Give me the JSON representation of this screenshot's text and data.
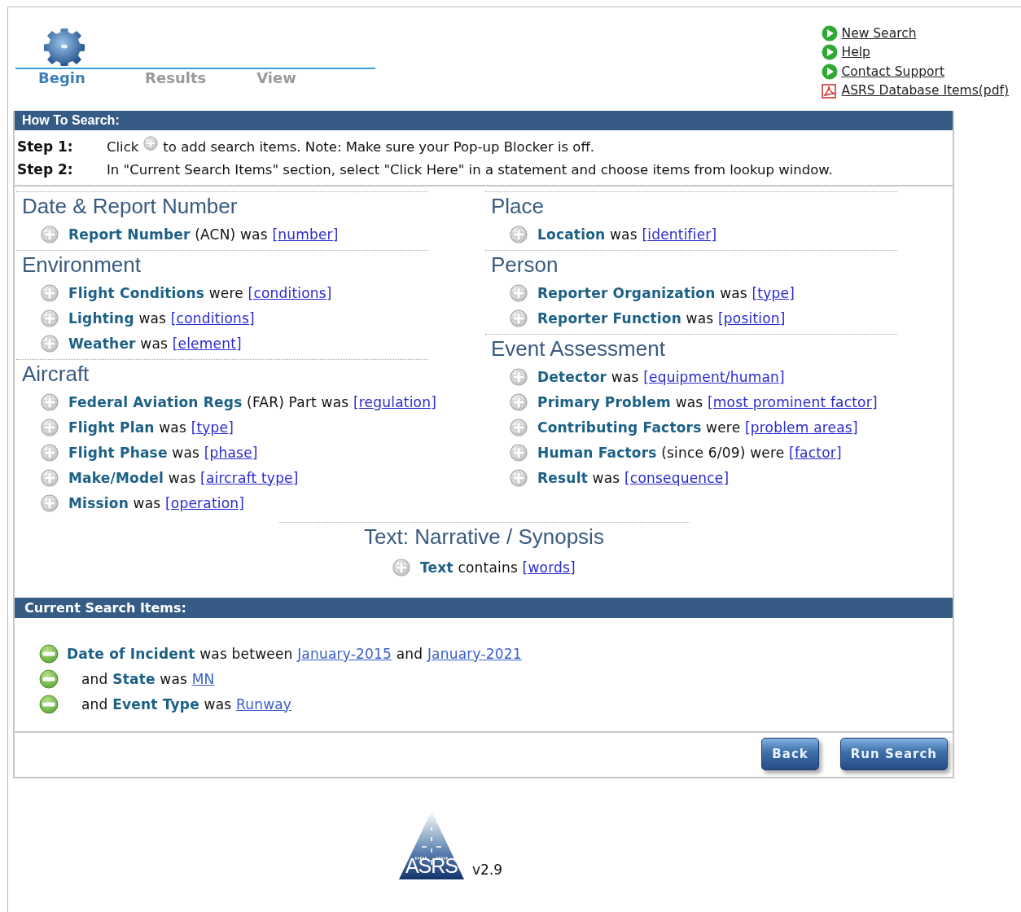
{
  "steps": [
    {
      "label": "Begin",
      "selected": true
    },
    {
      "label": "Results",
      "selected": false
    },
    {
      "label": "View",
      "selected": false
    }
  ],
  "top_links": [
    {
      "kind": "arrow",
      "label": "New Search"
    },
    {
      "kind": "arrow",
      "label": "Help"
    },
    {
      "kind": "arrow",
      "label": "Contact Support"
    },
    {
      "kind": "pdf",
      "label": "ASRS Database Items(pdf)"
    }
  ],
  "how_to": {
    "title": "How To Search:",
    "steps": [
      {
        "label": "Step 1:",
        "before": "Click",
        "after": "to add search items. Note: Make sure your Pop-up Blocker is off."
      },
      {
        "label": "Step 2:",
        "text": "In \"Current Search Items\" section, select \"Click Here\" in a statement and choose items from lookup window."
      }
    ]
  },
  "columns": [
    [
      {
        "title": "Date & Report Number",
        "items": [
          [
            {
              "kind": "bold",
              "text": "Report Number"
            },
            {
              "kind": "plain",
              "text": "(ACN) was"
            },
            {
              "kind": "link",
              "text": "[number]"
            }
          ]
        ]
      },
      {
        "title": "Environment",
        "items": [
          [
            {
              "kind": "bold",
              "text": "Flight Conditions"
            },
            {
              "kind": "plain",
              "text": "were"
            },
            {
              "kind": "link",
              "text": "[conditions]"
            }
          ],
          [
            {
              "kind": "bold",
              "text": "Lighting"
            },
            {
              "kind": "plain",
              "text": "was"
            },
            {
              "kind": "link",
              "text": "[conditions]"
            }
          ],
          [
            {
              "kind": "bold",
              "text": "Weather"
            },
            {
              "kind": "plain",
              "text": "was"
            },
            {
              "kind": "link",
              "text": "[element]"
            }
          ]
        ]
      },
      {
        "title": "Aircraft",
        "items": [
          [
            {
              "kind": "bold",
              "text": "Federal Aviation Regs"
            },
            {
              "kind": "plain",
              "text": "(FAR) Part was"
            },
            {
              "kind": "link",
              "text": "[regulation]"
            }
          ],
          [
            {
              "kind": "bold",
              "text": "Flight Plan"
            },
            {
              "kind": "plain",
              "text": "was"
            },
            {
              "kind": "link",
              "text": "[type]"
            }
          ],
          [
            {
              "kind": "bold",
              "text": "Flight Phase"
            },
            {
              "kind": "plain",
              "text": "was"
            },
            {
              "kind": "link",
              "text": "[phase]"
            }
          ],
          [
            {
              "kind": "bold",
              "text": "Make/Model"
            },
            {
              "kind": "plain",
              "text": "was"
            },
            {
              "kind": "link",
              "text": "[aircraft type]"
            }
          ],
          [
            {
              "kind": "bold",
              "text": "Mission"
            },
            {
              "kind": "plain",
              "text": "was"
            },
            {
              "kind": "link",
              "text": "[operation]"
            }
          ]
        ]
      }
    ],
    [
      {
        "title": "Place",
        "items": [
          [
            {
              "kind": "bold",
              "text": "Location"
            },
            {
              "kind": "plain",
              "text": "was"
            },
            {
              "kind": "link",
              "text": "[identifier]"
            }
          ]
        ]
      },
      {
        "title": "Person",
        "items": [
          [
            {
              "kind": "bold",
              "text": "Reporter Organization"
            },
            {
              "kind": "plain",
              "text": "was"
            },
            {
              "kind": "link",
              "text": "[type]"
            }
          ],
          [
            {
              "kind": "bold",
              "text": "Reporter Function"
            },
            {
              "kind": "plain",
              "text": "was"
            },
            {
              "kind": "link",
              "text": "[position]"
            }
          ]
        ]
      },
      {
        "title": "Event Assessment",
        "items": [
          [
            {
              "kind": "bold",
              "text": "Detector"
            },
            {
              "kind": "plain",
              "text": "was"
            },
            {
              "kind": "link",
              "text": "[equipment/human]"
            }
          ],
          [
            {
              "kind": "bold",
              "text": "Primary Problem"
            },
            {
              "kind": "plain",
              "text": "was"
            },
            {
              "kind": "link",
              "text": "[most prominent factor]"
            }
          ],
          [
            {
              "kind": "bold",
              "text": "Contributing Factors"
            },
            {
              "kind": "plain",
              "text": "were"
            },
            {
              "kind": "link",
              "text": "[problem areas]"
            }
          ],
          [
            {
              "kind": "bold",
              "text": "Human Factors"
            },
            {
              "kind": "plain",
              "text": "(since 6/09) were"
            },
            {
              "kind": "link",
              "text": "[factor]"
            }
          ],
          [
            {
              "kind": "bold",
              "text": "Result"
            },
            {
              "kind": "plain",
              "text": "was"
            },
            {
              "kind": "link",
              "text": "[consequence]"
            }
          ]
        ]
      }
    ]
  ],
  "narrative": {
    "title": "Text: Narrative / Synopsis",
    "items": [
      [
        {
          "kind": "bold",
          "text": "Text"
        },
        {
          "kind": "plain",
          "text": "contains"
        },
        {
          "kind": "link",
          "text": "[words]"
        }
      ]
    ]
  },
  "current": {
    "title": "Current Search Items:",
    "items": [
      [
        {
          "kind": "bold",
          "text": "Date of Incident"
        },
        {
          "kind": "plain",
          "text": "was between"
        },
        {
          "kind": "link",
          "text": "January-2015"
        },
        {
          "kind": "plain",
          "text": "and"
        },
        {
          "kind": "link",
          "text": "January-2021"
        }
      ],
      [
        {
          "kind": "plain",
          "text": "and"
        },
        {
          "kind": "bold",
          "text": "State"
        },
        {
          "kind": "plain",
          "text": "was"
        },
        {
          "kind": "link",
          "text": "MN"
        }
      ],
      [
        {
          "kind": "plain",
          "text": "and"
        },
        {
          "kind": "bold",
          "text": "Event Type"
        },
        {
          "kind": "plain",
          "text": "was"
        },
        {
          "kind": "link",
          "text": "Runway"
        }
      ]
    ]
  },
  "buttons": [
    "Back",
    "Run Search"
  ],
  "footer": {
    "logo_text": "ASRS",
    "version": "v2.9"
  }
}
